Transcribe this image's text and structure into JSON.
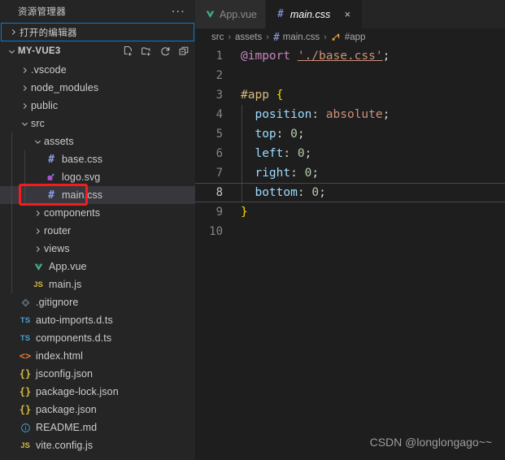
{
  "sidebar": {
    "title": "资源管理器",
    "more_actions_label": "...",
    "open_editors": {
      "label": "打开的编辑器",
      "expanded": false
    },
    "project": {
      "name": "MY-VUE3",
      "expanded": true,
      "actions": [
        {
          "name": "new-file-icon",
          "label": "新建文件"
        },
        {
          "name": "new-folder-icon",
          "label": "新建文件夹"
        },
        {
          "name": "refresh-icon",
          "label": "刷新资源管理器"
        },
        {
          "name": "collapse-all-icon",
          "label": "在资源管理器中折叠文件夹"
        }
      ]
    },
    "tree": [
      {
        "label": ".vscode",
        "depth": 1,
        "kind": "folder",
        "expanded": false,
        "icon": "chevron-right-icon",
        "selected": false
      },
      {
        "label": "node_modules",
        "depth": 1,
        "kind": "folder",
        "expanded": false,
        "icon": "chevron-right-icon",
        "selected": false
      },
      {
        "label": "public",
        "depth": 1,
        "kind": "folder",
        "expanded": false,
        "icon": "chevron-right-icon",
        "selected": false
      },
      {
        "label": "src",
        "depth": 1,
        "kind": "folder",
        "expanded": true,
        "icon": "chevron-down-icon",
        "selected": false
      },
      {
        "label": "assets",
        "depth": 2,
        "kind": "folder",
        "expanded": true,
        "icon": "chevron-down-icon",
        "selected": false
      },
      {
        "label": "base.css",
        "depth": 3,
        "kind": "file",
        "icon": "css-file-icon",
        "selected": false
      },
      {
        "label": "logo.svg",
        "depth": 3,
        "kind": "file",
        "icon": "svg-file-icon",
        "selected": false
      },
      {
        "label": "main.css",
        "depth": 3,
        "kind": "file",
        "icon": "css-file-icon",
        "selected": true
      },
      {
        "label": "components",
        "depth": 2,
        "kind": "folder",
        "expanded": false,
        "icon": "chevron-right-icon",
        "selected": false
      },
      {
        "label": "router",
        "depth": 2,
        "kind": "folder",
        "expanded": false,
        "icon": "chevron-right-icon",
        "selected": false
      },
      {
        "label": "views",
        "depth": 2,
        "kind": "folder",
        "expanded": false,
        "icon": "chevron-right-icon",
        "selected": false
      },
      {
        "label": "App.vue",
        "depth": 2,
        "kind": "file",
        "icon": "vue-file-icon",
        "selected": false
      },
      {
        "label": "main.js",
        "depth": 2,
        "kind": "file",
        "icon": "js-file-icon",
        "selected": false
      },
      {
        "label": ".gitignore",
        "depth": 1,
        "kind": "file",
        "icon": "git-file-icon",
        "selected": false
      },
      {
        "label": "auto-imports.d.ts",
        "depth": 1,
        "kind": "file",
        "icon": "ts-file-icon",
        "selected": false
      },
      {
        "label": "components.d.ts",
        "depth": 1,
        "kind": "file",
        "icon": "ts-file-icon",
        "selected": false
      },
      {
        "label": "index.html",
        "depth": 1,
        "kind": "file",
        "icon": "html-file-icon",
        "selected": false
      },
      {
        "label": "jsconfig.json",
        "depth": 1,
        "kind": "file",
        "icon": "json-file-icon",
        "selected": false
      },
      {
        "label": "package-lock.json",
        "depth": 1,
        "kind": "file",
        "icon": "json-file-icon",
        "selected": false
      },
      {
        "label": "package.json",
        "depth": 1,
        "kind": "file",
        "icon": "json-file-icon",
        "selected": false
      },
      {
        "label": "README.md",
        "depth": 1,
        "kind": "file",
        "icon": "markdown-file-icon",
        "selected": false
      },
      {
        "label": "vite.config.js",
        "depth": 1,
        "kind": "file",
        "icon": "js-file-icon",
        "selected": false
      }
    ]
  },
  "editor": {
    "tabs": [
      {
        "label": "App.vue",
        "icon": "vue-file-icon",
        "active": false,
        "closable": false
      },
      {
        "label": "main.css",
        "icon": "css-file-icon",
        "active": true,
        "closable": true,
        "close_label": "×"
      }
    ],
    "breadcrumb": [
      {
        "label": "src",
        "icon": null
      },
      {
        "label": "assets",
        "icon": null
      },
      {
        "label": "main.css",
        "icon": "css-file-icon"
      },
      {
        "label": "#app",
        "icon": "css-symbol-icon"
      }
    ],
    "breadcrumb_separator": "›",
    "active_line": 8,
    "lines": [
      {
        "n": 1,
        "tokens": [
          {
            "t": "@import",
            "c": "at"
          },
          {
            "t": " ",
            "c": "punc"
          },
          {
            "t": "'./base.css'",
            "c": "str"
          },
          {
            "t": ";",
            "c": "punc"
          }
        ]
      },
      {
        "n": 2,
        "tokens": []
      },
      {
        "n": 3,
        "tokens": [
          {
            "t": "#app",
            "c": "sel"
          },
          {
            "t": " ",
            "c": "punc"
          },
          {
            "t": "{",
            "c": "brace"
          }
        ]
      },
      {
        "n": 4,
        "tokens": [
          {
            "t": "  ",
            "c": "punc"
          },
          {
            "t": "position",
            "c": "prop"
          },
          {
            "t": ":",
            "c": "colon"
          },
          {
            "t": " ",
            "c": "punc"
          },
          {
            "t": "absolute",
            "c": "val"
          },
          {
            "t": ";",
            "c": "punc"
          }
        ]
      },
      {
        "n": 5,
        "tokens": [
          {
            "t": "  ",
            "c": "punc"
          },
          {
            "t": "top",
            "c": "prop"
          },
          {
            "t": ":",
            "c": "colon"
          },
          {
            "t": " ",
            "c": "punc"
          },
          {
            "t": "0",
            "c": "num"
          },
          {
            "t": ";",
            "c": "punc"
          }
        ]
      },
      {
        "n": 6,
        "tokens": [
          {
            "t": "  ",
            "c": "punc"
          },
          {
            "t": "left",
            "c": "prop"
          },
          {
            "t": ":",
            "c": "colon"
          },
          {
            "t": " ",
            "c": "punc"
          },
          {
            "t": "0",
            "c": "num"
          },
          {
            "t": ";",
            "c": "punc"
          }
        ]
      },
      {
        "n": 7,
        "tokens": [
          {
            "t": "  ",
            "c": "punc"
          },
          {
            "t": "right",
            "c": "prop"
          },
          {
            "t": ":",
            "c": "colon"
          },
          {
            "t": " ",
            "c": "punc"
          },
          {
            "t": "0",
            "c": "num"
          },
          {
            "t": ";",
            "c": "punc"
          }
        ]
      },
      {
        "n": 8,
        "tokens": [
          {
            "t": "  ",
            "c": "punc"
          },
          {
            "t": "bottom",
            "c": "prop"
          },
          {
            "t": ":",
            "c": "colon"
          },
          {
            "t": " ",
            "c": "punc"
          },
          {
            "t": "0",
            "c": "num"
          },
          {
            "t": ";",
            "c": "punc"
          }
        ]
      },
      {
        "n": 9,
        "tokens": [
          {
            "t": "}",
            "c": "brace"
          }
        ]
      },
      {
        "n": 10,
        "tokens": []
      }
    ]
  },
  "watermark": "CSDN @longlongago~~",
  "colors": {
    "sidebar_bg": "#252526",
    "editor_bg": "#1e1e1e",
    "tab_inactive_bg": "#2d2d2d",
    "selection_bg": "#37373d",
    "focus_border": "#007fd4",
    "annotation_red": "#f81b1b",
    "accent_css_icon": "#8a9fe8"
  }
}
